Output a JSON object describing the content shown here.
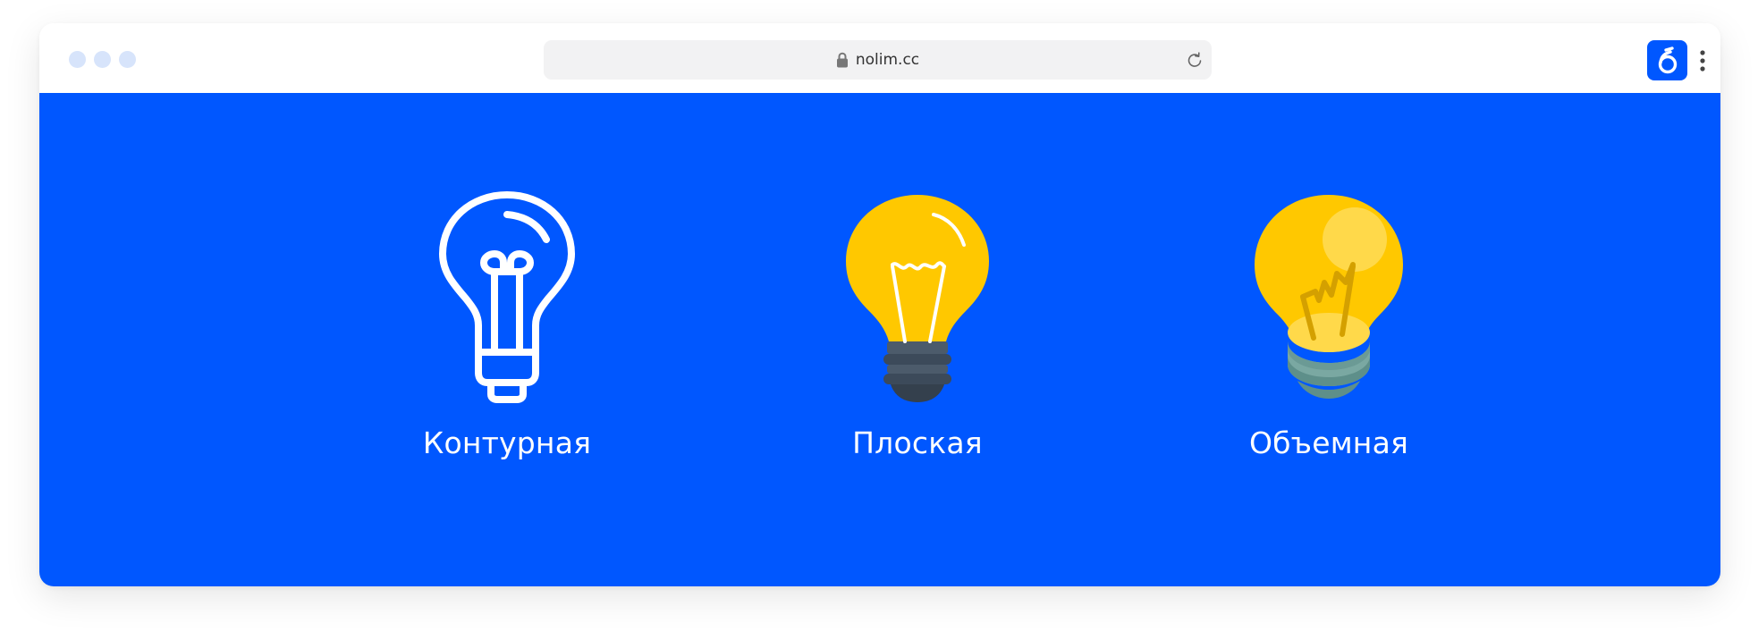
{
  "browser": {
    "url": "nolim.cc",
    "window_controls": [
      "dot",
      "dot",
      "dot"
    ],
    "extension_glyph": "ó",
    "icons": {
      "lock": "lock-icon",
      "reload": "reload-icon",
      "menu": "more-vertical-icon"
    }
  },
  "page": {
    "background_color": "#0057ff",
    "items": [
      {
        "label": "Контурная",
        "icon": "lightbulb-outline-icon"
      },
      {
        "label": "Плоская",
        "icon": "lightbulb-flat-icon"
      },
      {
        "label": "Объемная",
        "icon": "lightbulb-3d-icon"
      }
    ]
  },
  "colors": {
    "accent": "#0057ff",
    "bulb_yellow": "#ffc800",
    "flat_base": "#3c4a5a",
    "volume_base": "#6e9c98"
  }
}
